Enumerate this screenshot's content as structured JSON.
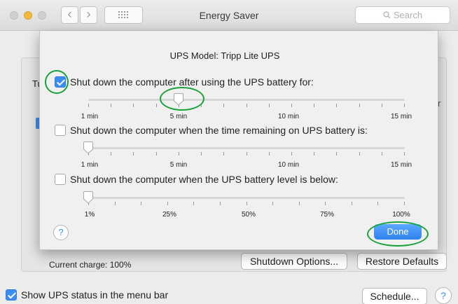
{
  "window": {
    "title": "Energy Saver"
  },
  "search": {
    "placeholder": "Search"
  },
  "sheet": {
    "ups_model_label": "UPS Model:",
    "ups_model_value": "Tripp Lite UPS",
    "options": [
      {
        "label": "Shut down the computer after using the UPS battery for:",
        "checked": true,
        "slider_labels": [
          "1 min",
          "5 min",
          "10 min",
          "15 min"
        ],
        "value_minutes": 5
      },
      {
        "label": "Shut down the computer when the time remaining on UPS battery is:",
        "checked": false,
        "slider_labels": [
          "1 min",
          "5 min",
          "10 min",
          "15 min"
        ],
        "value_minutes": 1
      },
      {
        "label": "Shut down the computer when the UPS battery level is below:",
        "checked": false,
        "slider_labels": [
          "1%",
          "25%",
          "50%",
          "75%",
          "100%"
        ],
        "value_percent": 1
      }
    ],
    "help_label": "?",
    "done_label": "Done"
  },
  "background": {
    "partial_left_text": "Tu",
    "partial_right_text": "r",
    "current_charge": "Current charge: 100%",
    "shutdown_options_label": "Shutdown Options...",
    "restore_defaults_label": "Restore Defaults",
    "show_ups_status_label": "Show UPS status in the menu bar",
    "show_ups_status_checked": true,
    "schedule_label": "Schedule...",
    "help_label": "?"
  },
  "colors": {
    "accent": "#3b8ef0",
    "annotation": "#1aa23a",
    "minimize": "#f5b93a"
  }
}
